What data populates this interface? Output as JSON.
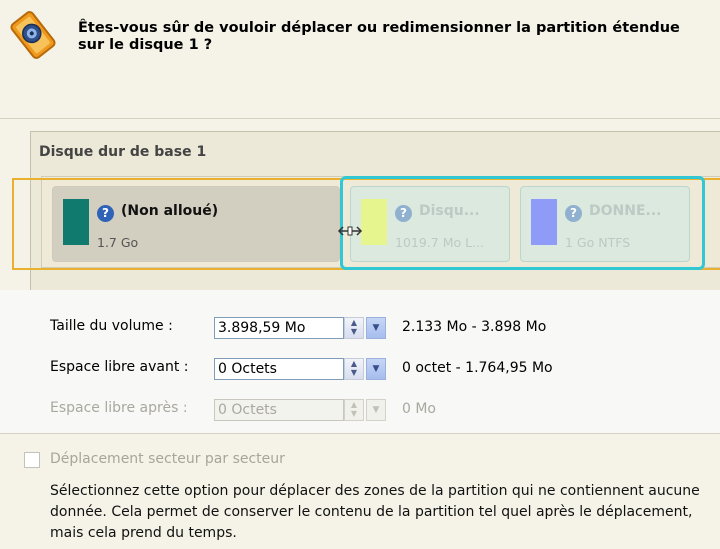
{
  "header": {
    "title": "Êtes-vous sûr de vouloir déplacer ou redimensionner la partition étendue sur le disque 1 ?"
  },
  "disk": {
    "title": "Disque dur de base 1",
    "partitions": [
      {
        "name": "(Non alloué)",
        "size": "1.7 Go",
        "color": "#0f7a6d"
      },
      {
        "name": "Disqu...",
        "size": "1019.7 Mo L...",
        "color": "#e6f58e"
      },
      {
        "name": "DONNE...",
        "size": "1 Go NTFS",
        "color": "#8f9cf7"
      }
    ]
  },
  "form": {
    "volume_size": {
      "label": "Taille du volume :",
      "value": "3.898,59 Mo",
      "range": "2.133 Mo - 3.898 Mo"
    },
    "free_before": {
      "label": "Espace libre avant :",
      "value": "0 Octets",
      "range": "0 octet - 1.764,95 Mo"
    },
    "free_after": {
      "label": "Espace libre après :",
      "value": "0 Octets",
      "range": "0 Mo"
    }
  },
  "option": {
    "label": "Déplacement secteur par secteur",
    "description": "Sélectionnez cette option pour déplacer des zones de la partition qui ne contiennent aucune donnée. Cela permet de conserver le contenu de la partition tel quel après le déplacement, mais cela prend du temps."
  },
  "colors": {
    "selection_outline": "#e9b12f",
    "extended_outline": "#31c7d3",
    "help_icon": "#2f63b8"
  }
}
